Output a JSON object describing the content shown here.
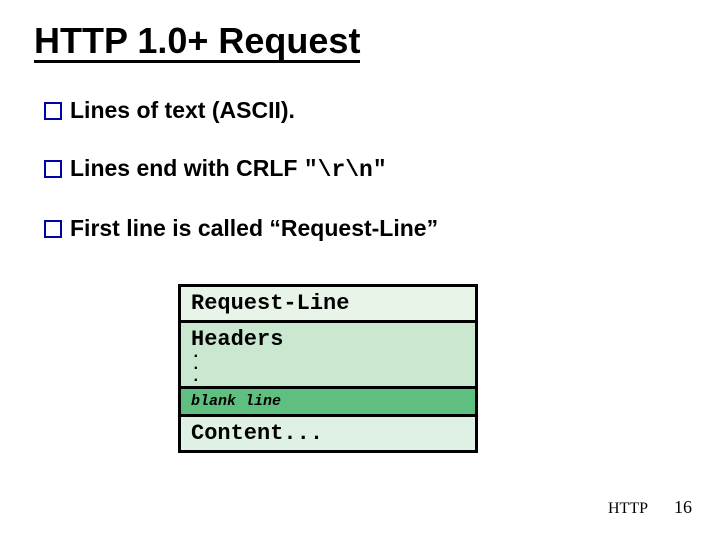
{
  "title": "HTTP 1.0+ Request",
  "bullets": [
    {
      "text": "Lines of text (ASCII)."
    },
    {
      "prefix": "Lines end with CRLF  ",
      "mono": "\"\\r\\n\""
    },
    {
      "text": "First line is called “Request-Line”"
    }
  ],
  "diagram": {
    "requestLine": "Request-Line",
    "headers": "Headers",
    "dots": ".\n.\n.",
    "blank": "blank line",
    "content": "Content..."
  },
  "footer": {
    "label": "HTTP",
    "page": "16"
  }
}
